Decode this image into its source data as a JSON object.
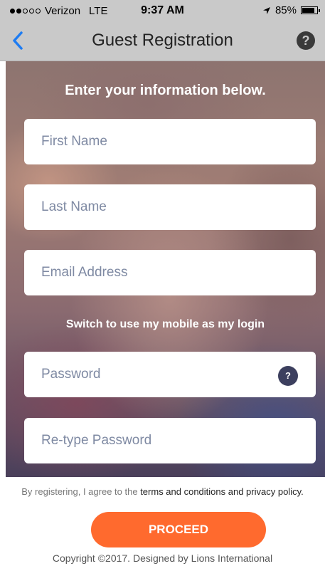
{
  "status_bar": {
    "carrier": "Verizon",
    "network": "LTE",
    "time": "9:37 AM",
    "battery_percent": "85%",
    "battery_level": 0.85,
    "signal_bars": 2,
    "signal_total": 5
  },
  "nav": {
    "title": "Guest Registration",
    "back_icon": "chevron-left-icon",
    "help_label": "?",
    "accent_color": "#1e7cf2"
  },
  "form": {
    "heading": "Enter your information below.",
    "first_name_placeholder": "First Name",
    "last_name_placeholder": "Last Name",
    "email_placeholder": "Email Address",
    "switch_login_text": "Switch to use my mobile as my login",
    "password_placeholder": "Password",
    "password_help_label": "?",
    "retype_password_placeholder": "Re-type Password"
  },
  "footer": {
    "terms_prefix": "By registering, I agree to the ",
    "terms_link": "terms and conditions and privacy policy.",
    "proceed_label": "PROCEED",
    "proceed_color": "#ff6a2e",
    "copyright": "Copyright ©2017. Designed by Lions International"
  }
}
